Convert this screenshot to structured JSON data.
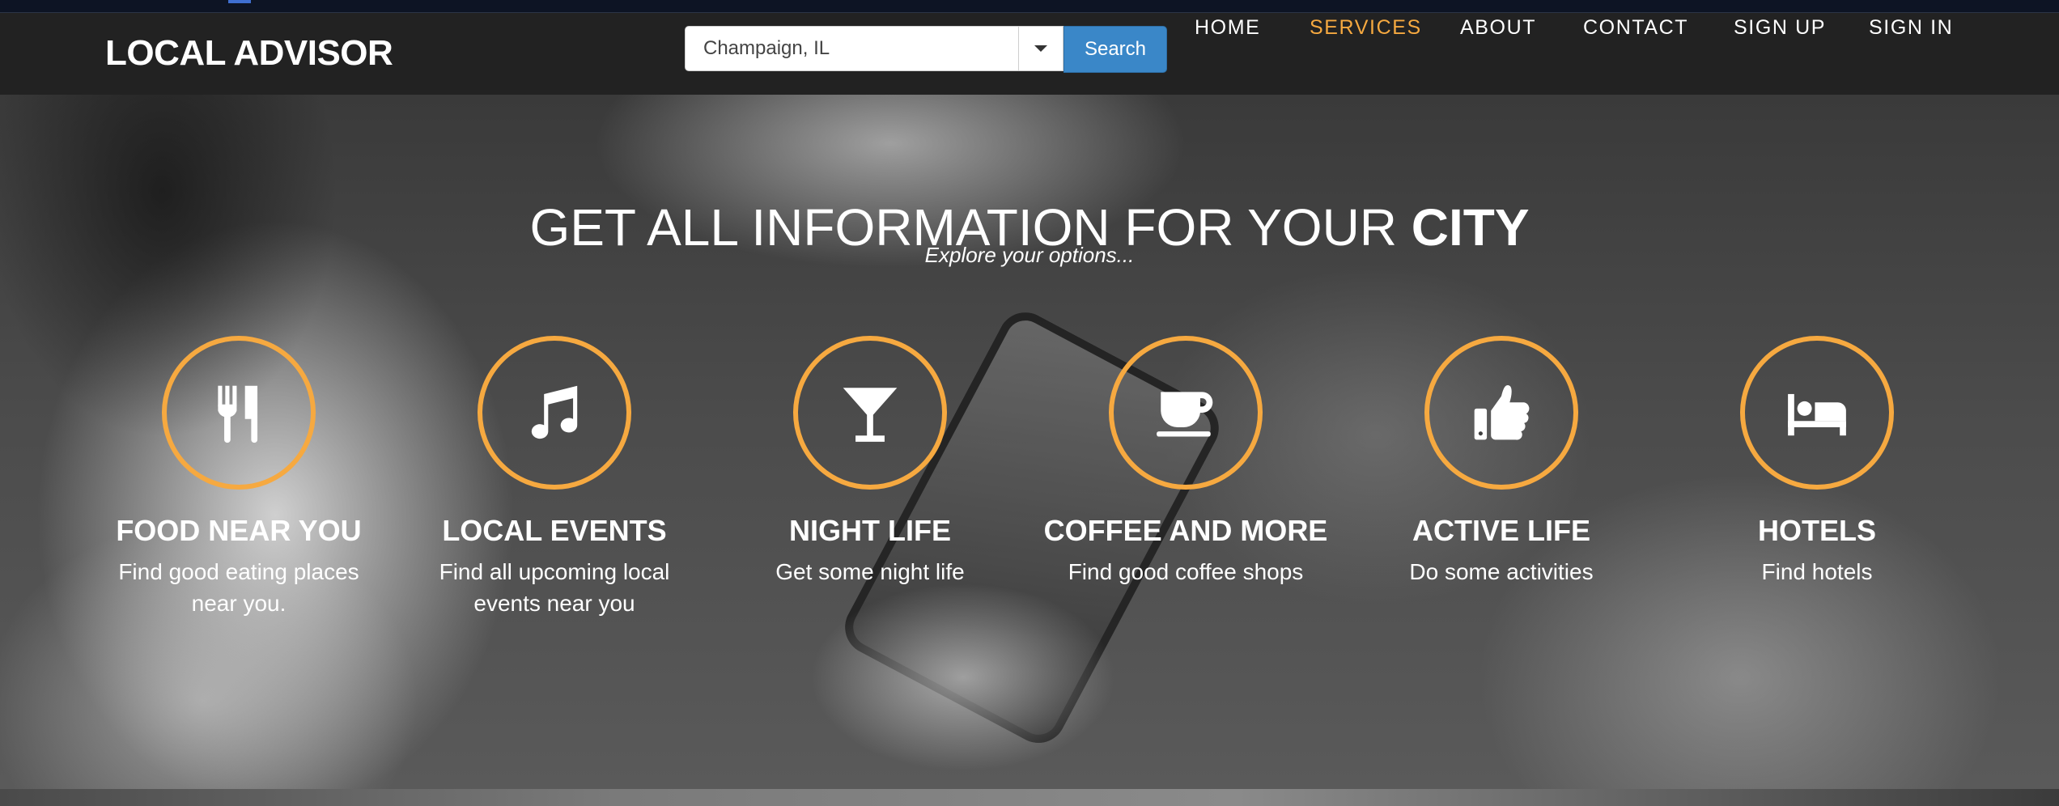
{
  "brand": "LOCAL ADVISOR",
  "search": {
    "value": "Champaign, IL",
    "button_label": "Search"
  },
  "nav": [
    {
      "label": "HOME",
      "active": false
    },
    {
      "label": "SERVICES",
      "active": true
    },
    {
      "label": "ABOUT",
      "active": false
    },
    {
      "label": "CONTACT",
      "active": false
    },
    {
      "label": "SIGN UP",
      "active": false
    },
    {
      "label": "SIGN IN",
      "active": false
    }
  ],
  "hero": {
    "headline_light": "GET ALL INFORMATION FOR YOUR ",
    "headline_bold": "CITY",
    "subline": "Explore your options..."
  },
  "services": [
    {
      "icon": "utensils-icon",
      "title": "FOOD NEAR YOU",
      "description": "Find good eating places near you."
    },
    {
      "icon": "music-icon",
      "title": "LOCAL EVENTS",
      "description": "Find all upcoming local events near you"
    },
    {
      "icon": "cocktail-icon",
      "title": "NIGHT LIFE",
      "description": "Get some night life"
    },
    {
      "icon": "coffee-cup-icon",
      "title": "COFFEE AND MORE",
      "description": "Find good coffee shops"
    },
    {
      "icon": "thumbs-up-icon",
      "title": "ACTIVE LIFE",
      "description": "Do some activities"
    },
    {
      "icon": "bed-icon",
      "title": "HOTELS",
      "description": "Find hotels"
    }
  ],
  "colors": {
    "accent": "#f6a940",
    "navbar": "#222222",
    "search_button": "#3a87c8"
  }
}
